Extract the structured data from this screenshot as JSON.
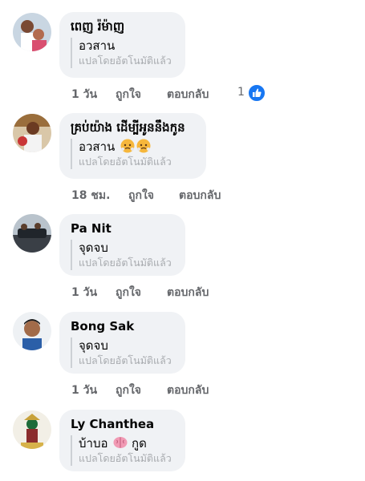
{
  "comments": [
    {
      "name": "ពេញ រ៉ម៉ាញ",
      "text": "อวสาน",
      "translated_note": "แปลโดยอัตโนมัติแล้ว",
      "time": "1 วัน",
      "like_label": "ถูกใจ",
      "reply_label": "ตอบกลับ",
      "reaction_count": "1"
    },
    {
      "name": "គ្រប់យ៉ាង ដើម្បីអូននឹងកូន",
      "text": "อวสาน",
      "translated_note": "แปลโดยอัตโนมัติแล้ว",
      "time": "18 ชม.",
      "like_label": "ถูกใจ",
      "reply_label": "ตอบกลับ"
    },
    {
      "name": "Pa Nit",
      "text": "จุดจบ",
      "translated_note": "แปลโดยอัตโนมัติแล้ว",
      "time": "1 วัน",
      "like_label": "ถูกใจ",
      "reply_label": "ตอบกลับ"
    },
    {
      "name": "Bong Sak",
      "text": "จุดจบ",
      "translated_note": "แปลโดยอัตโนมัติแล้ว",
      "time": "1 วัน",
      "like_label": "ถูกใจ",
      "reply_label": "ตอบกลับ"
    },
    {
      "name": "Ly Chanthea",
      "text": "บ้าบอ",
      "text_suffix": "กูด",
      "translated_note": "แปลโดยอัตโนมัติแล้ว"
    }
  ],
  "colors": {
    "bubble_bg": "#f0f2f5",
    "like_badge": "#1877f2",
    "meta_text": "#65676b"
  },
  "icons": {
    "reaction": "like-thumbs-up-icon",
    "emoji_face": "triumph-face-emoji",
    "emoji_brain": "brain-emoji"
  }
}
